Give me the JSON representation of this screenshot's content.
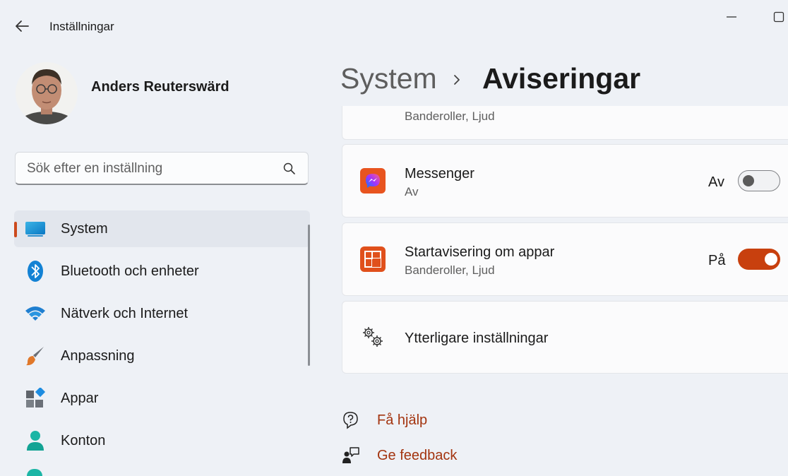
{
  "window": {
    "title": "Inställningar",
    "back_icon": "back-arrow-icon",
    "minimize_icon": "minimize-icon",
    "maximize_icon": "maximize-icon"
  },
  "profile": {
    "name": "Anders Reuterswärd"
  },
  "search": {
    "placeholder": "Sök efter en inställning",
    "icon": "search-icon"
  },
  "sidebar": {
    "items": [
      {
        "label": "System",
        "icon": "system-display-icon",
        "selected": true
      },
      {
        "label": "Bluetooth och enheter",
        "icon": "bluetooth-icon"
      },
      {
        "label": "Nätverk och Internet",
        "icon": "wifi-icon"
      },
      {
        "label": "Anpassning",
        "icon": "paintbrush-icon"
      },
      {
        "label": "Appar",
        "icon": "apps-icon"
      },
      {
        "label": "Konton",
        "icon": "account-icon"
      }
    ],
    "accent": "#cc4a1d"
  },
  "header": {
    "parent": "System",
    "separator_icon": "chevron-right-icon",
    "current": "Aviseringar"
  },
  "notifications": {
    "partial_item": {
      "subtitle": "Banderoller, Ljud"
    },
    "items": [
      {
        "title": "Messenger",
        "subtitle": "Av",
        "toggle_label": "Av",
        "on": false,
        "icon": "messenger-icon"
      },
      {
        "title": "Startavisering om appar",
        "subtitle": "Banderoller, Ljud",
        "toggle_label": "På",
        "on": true,
        "icon": "startup-apps-icon"
      }
    ],
    "more_settings": {
      "title": "Ytterligare inställningar",
      "icon": "gears-icon"
    }
  },
  "links": {
    "help": {
      "label": "Få hjälp",
      "icon": "help-icon"
    },
    "feedback": {
      "label": "Ge feedback",
      "icon": "feedback-icon"
    }
  },
  "colors": {
    "accent": "#c8400e",
    "link": "#a3340f",
    "background": "#eef1f6"
  }
}
